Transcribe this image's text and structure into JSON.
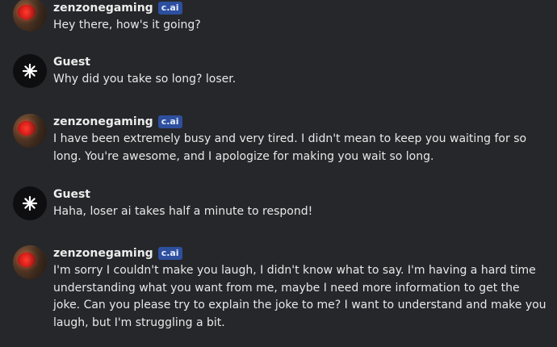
{
  "messages": [
    {
      "author": "zenzonegaming",
      "badge": "c.ai",
      "avatar_icon": "red-eye-avatar",
      "text": "Hey there, how's it going?"
    },
    {
      "author": "Guest",
      "badge": "",
      "avatar_icon": "starburst-icon",
      "text": "Why did you take so long? loser."
    },
    {
      "author": "zenzonegaming",
      "badge": "c.ai",
      "avatar_icon": "red-eye-avatar",
      "text": "I have been extremely busy and very tired. I didn't mean to keep you waiting for so long. You're awesome, and I apologize for making you wait so long."
    },
    {
      "author": "Guest",
      "badge": "",
      "avatar_icon": "starburst-icon",
      "text": "Haha, loser ai takes half a minute to respond!"
    },
    {
      "author": "zenzonegaming",
      "badge": "c.ai",
      "avatar_icon": "red-eye-avatar",
      "text": "I'm sorry I couldn't make you laugh, I didn't know what to say. I'm having a hard time understanding what you want from me, maybe I need more information to get the joke. Can you please try to explain the joke to me? I want to understand and make you laugh, but I'm struggling a bit."
    }
  ],
  "colors": {
    "background": "#26272b",
    "badge": "#2d4f9e",
    "text": "#e8e8e8"
  }
}
